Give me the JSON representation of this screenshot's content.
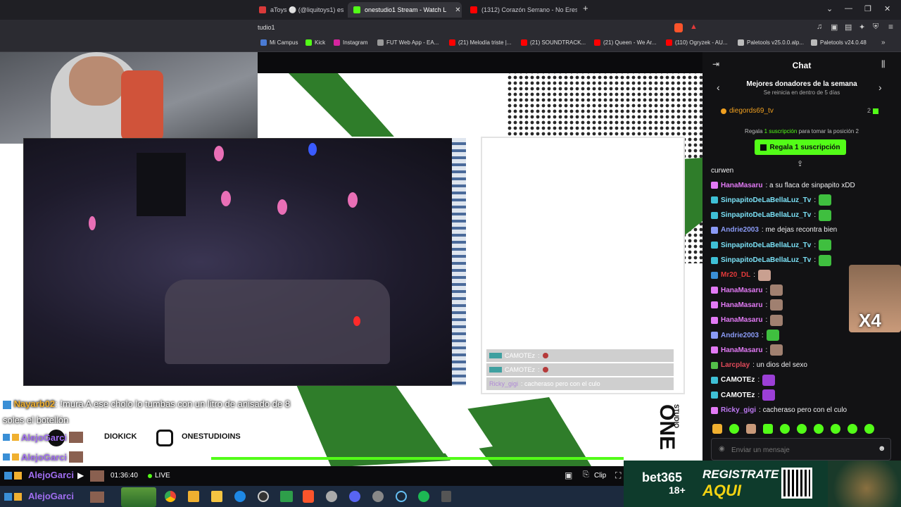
{
  "browser": {
    "tabs": [
      {
        "label": "aToys ⚪ (@liquitoys1) está LIVE",
        "active": false,
        "fav_color": "#d93a3a"
      },
      {
        "label": "onestudio1 Stream - Watch L",
        "active": true,
        "fav_color": "#53fc18"
      },
      {
        "label": "(1312) Corazón Serrano - No Eres Ú",
        "active": false,
        "fav_color": "#ff0000"
      }
    ],
    "new_tab": "+",
    "url": "tudio1",
    "bookmarks": [
      {
        "label": "Mi Campus",
        "color": "#4a7bd4"
      },
      {
        "label": "Kick",
        "color": "#53fc18"
      },
      {
        "label": "Instagram",
        "color": "#d6249f"
      },
      {
        "label": "FUT Web App - EA...",
        "color": "#999999"
      },
      {
        "label": "(21) Melodía triste |...",
        "color": "#ff0000"
      },
      {
        "label": "(21) SOUNDTRACK...",
        "color": "#ff0000"
      },
      {
        "label": "(21) Queen - We Ar...",
        "color": "#ff0000"
      },
      {
        "label": "(110) Ogryzek - AU...",
        "color": "#ff0000"
      },
      {
        "label": "Paletools v25.0.0.alp...",
        "color": "#bbbbbb"
      },
      {
        "label": "Paletools v24.0.48",
        "color": "#bbbbbb"
      }
    ]
  },
  "stream": {
    "overlay_chat": [
      {
        "user": "CAMOTEz",
        "text": ":"
      },
      {
        "user": "CAMOTEz",
        "text": ":"
      },
      {
        "user": "Ricky_gigi",
        "text": ": cacheraso pero con el culo"
      }
    ],
    "caption": {
      "user": "Nayarb02",
      "text": ": !mura A ese cholo lo tumbas con un litro de anisado de 8 soles el botellón"
    },
    "socials": [
      {
        "label": "DIOKICK"
      },
      {
        "label": "ONESTUDIOINS"
      }
    ],
    "side_user": "AlejoGarci",
    "logo_text": "ONE",
    "logo_sub": "STUDIO"
  },
  "player": {
    "time": "01:36:40",
    "live": "LIVE",
    "clip": "Clip"
  },
  "chat": {
    "title": "Chat",
    "donors_title": "Mejores donadores de la semana",
    "donors_sub": "Se reinicia en dentro de 5 días",
    "top_donor": "diegords69_tv",
    "top_donor_count": "2",
    "gift_prompt_pre": "Regala",
    "gift_prompt_link": "1 suscripción",
    "gift_prompt_post": "para tomar la posición 2",
    "gift_button": "Regala 1 suscripción",
    "first_user": "curwen",
    "messages": [
      {
        "user": "HanaMasaru",
        "color": "#e27af5",
        "text": ": a su flaca de sinpapito xDD",
        "emote": ""
      },
      {
        "user": "SinpapitoDeLaBellaLuz_Tv",
        "color": "#7ae0f5",
        "text": ":",
        "emote": "#3fbf3f"
      },
      {
        "user": "SinpapitoDeLaBellaLuz_Tv",
        "color": "#7ae0f5",
        "text": ":",
        "emote": "#3fbf3f"
      },
      {
        "user": "Andrie2003",
        "color": "#8a9af5",
        "text": ": me dejas recontra bien",
        "emote": ""
      },
      {
        "user": "SinpapitoDeLaBellaLuz_Tv",
        "color": "#7ae0f5",
        "text": ":",
        "emote": "#3fbf3f"
      },
      {
        "user": "SinpapitoDeLaBellaLuz_Tv",
        "color": "#7ae0f5",
        "text": ":",
        "emote": "#3fbf3f"
      },
      {
        "user": "Mr20_DL",
        "color": "#e23a3a",
        "text": ":",
        "emote": "#c9a090"
      },
      {
        "user": "HanaMasaru",
        "color": "#e27af5",
        "text": ":",
        "emote": "#a08070"
      },
      {
        "user": "HanaMasaru",
        "color": "#e27af5",
        "text": ":",
        "emote": "#a08070"
      },
      {
        "user": "HanaMasaru",
        "color": "#e27af5",
        "text": ":",
        "emote": "#a08070"
      },
      {
        "user": "Andrie2003",
        "color": "#8a9af5",
        "text": ":",
        "emote": "#3fbf3f"
      },
      {
        "user": "HanaMasaru",
        "color": "#e27af5",
        "text": ":",
        "emote": "#a08070"
      },
      {
        "user": "Larcplay",
        "color": "#e24a5a",
        "text": ": un dios del sexo",
        "emote": ""
      },
      {
        "user": "CAMOTEz",
        "color": "#ffffff",
        "text": ":",
        "emote": "#9b3fd6"
      },
      {
        "user": "CAMOTEz",
        "color": "#ffffff",
        "text": ":",
        "emote": "#9b3fd6"
      },
      {
        "user": "Ricky_gigi",
        "color": "#c07af5",
        "text": ": cacheraso pero con el culo",
        "emote": ""
      }
    ],
    "input_placeholder": "Enviar un mensaje",
    "sticker_overlay": "X4"
  },
  "ad": {
    "brand": "bet365",
    "age": "18+",
    "cta_line1": "REGISTRATE",
    "cta_line2": "AQUI"
  }
}
